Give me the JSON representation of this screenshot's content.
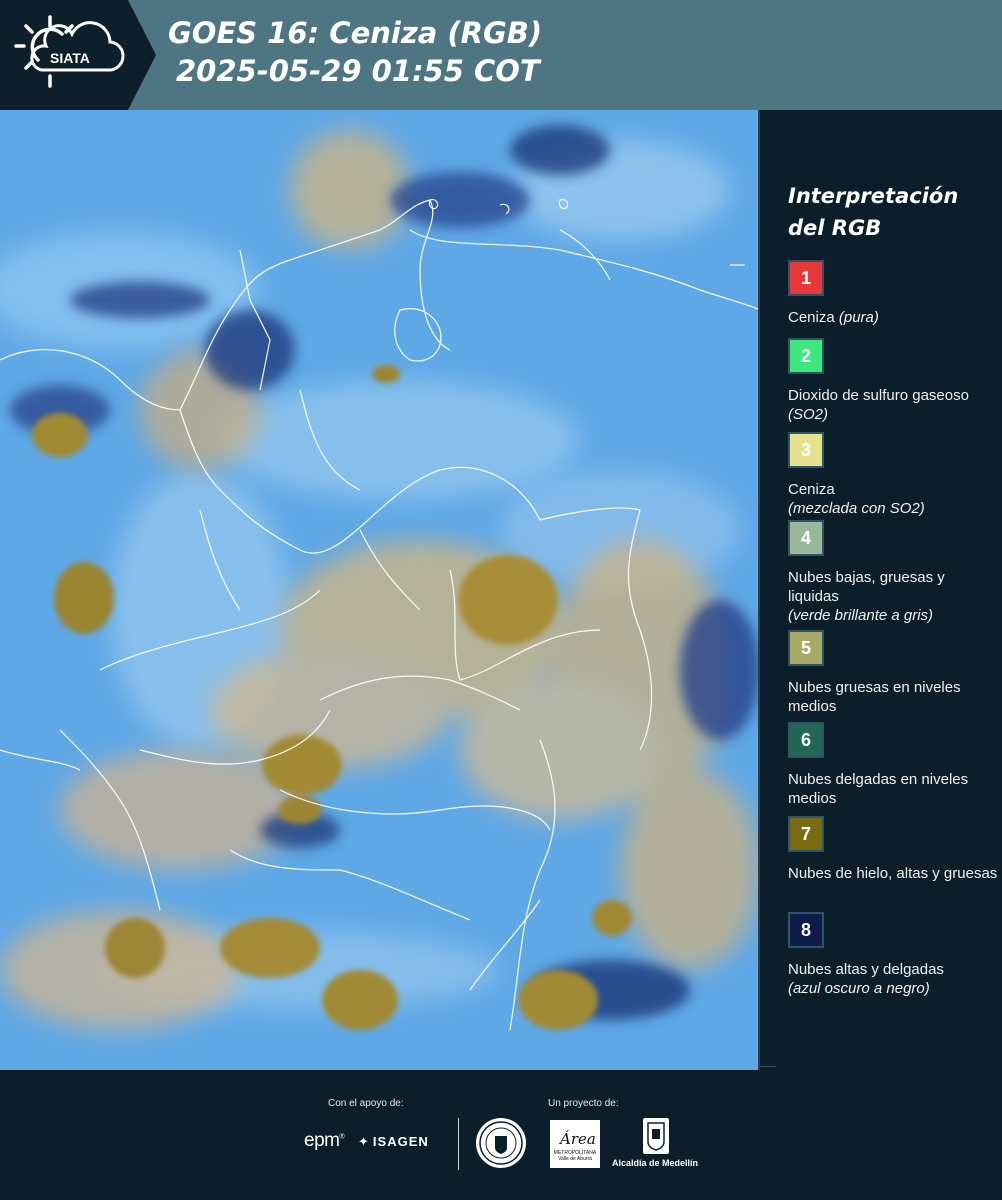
{
  "header": {
    "logo_text": "SIATA",
    "title_line1": "GOES 16: Ceniza (RGB)",
    "title_line2": "2025-05-29 01:55 COT"
  },
  "map": {
    "background_color": "#5ea9e6",
    "ice_cloud_color": "#a08a32",
    "border_color": "#ffffff"
  },
  "legend": {
    "title_line1": "Interpretación",
    "title_line2": "del RGB",
    "items": [
      {
        "num": "1",
        "color": "#e8383b",
        "text": "Ceniza ",
        "note": "(pura)"
      },
      {
        "num": "2",
        "color": "#3ee87e",
        "text": "Dioxido de sulfuro gaseoso ",
        "note": "(SO2)"
      },
      {
        "num": "3",
        "color": "#e7e08c",
        "text": "Ceniza",
        "note": "(mezclada con SO2)"
      },
      {
        "num": "4",
        "color": "#98b89a",
        "text": "Nubes bajas, gruesas y liquidas",
        "note": "(verde brillante a gris)"
      },
      {
        "num": "5",
        "color": "#a9aa66",
        "text": "Nubes gruesas en niveles medios",
        "note": ""
      },
      {
        "num": "6",
        "color": "#236655",
        "text": "Nubes delgadas en niveles medios",
        "note": ""
      },
      {
        "num": "7",
        "color": "#7a6a10",
        "text": "Nubes de hielo, altas y gruesas",
        "note": ""
      },
      {
        "num": "8",
        "color": "#0d1a4a",
        "text": "Nubes altas y delgadas",
        "note": "(azul oscuro a negro)"
      }
    ]
  },
  "footer": {
    "support_label": "Con el apoyo de:",
    "project_label": "Un proyecto de:",
    "epm": "epm",
    "isagen": "ISAGEN",
    "area_name": "METROPOLITANA",
    "area_sub": "Valle de Aburrá",
    "area_word": "Área",
    "alcaldia": "Alcaldía de Medellín"
  }
}
